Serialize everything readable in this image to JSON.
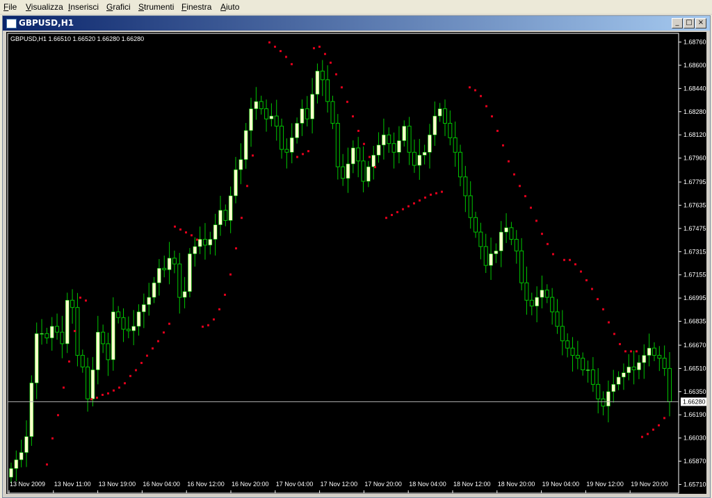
{
  "menu": [
    {
      "label": "File",
      "u": "F",
      "rest": "ile"
    },
    {
      "label": "Visualizza",
      "u": "V",
      "rest": "isualizza"
    },
    {
      "label": "Inserisci",
      "u": "I",
      "rest": "nserisci"
    },
    {
      "label": "Grafici",
      "u": "G",
      "rest": "rafici"
    },
    {
      "label": "Strumenti",
      "u": "S",
      "rest": "trumenti"
    },
    {
      "label": "Finestra",
      "u": "F",
      "rest": "inestra"
    },
    {
      "label": "Aiuto",
      "u": "A",
      "rest": "iuto"
    }
  ],
  "window": {
    "title": "GBPUSD,H1",
    "minimize_glyph": "_",
    "restore_glyph": "□",
    "close_glyph": "×"
  },
  "chart_header": "GBPUSD,H1  1.66510 1.66520 1.66280 1.66280",
  "current_price_label": "1.66280",
  "colors": {
    "background": "#000000",
    "bull_candle": "#ffffcc",
    "wick": "#00c800",
    "psar": "#e0001c",
    "axis_text": "#ffffff",
    "price_line": "#b4b4b4"
  },
  "chart_data": {
    "type": "candlestick",
    "symbol": "GBPUSD",
    "timeframe": "H1",
    "ylim": [
      1.6565,
      1.6882
    ],
    "y_ticks": [
      "1.68760",
      "1.68600",
      "1.68440",
      "1.68280",
      "1.68120",
      "1.67960",
      "1.67795",
      "1.67635",
      "1.67475",
      "1.67315",
      "1.67155",
      "1.66995",
      "1.66835",
      "1.66670",
      "1.66510",
      "1.66350",
      "1.66190",
      "1.66030",
      "1.65870",
      "1.65710"
    ],
    "x_ticks": [
      "13 Nov 2009",
      "13 Nov 11:00",
      "13 Nov 19:00",
      "16 Nov 04:00",
      "16 Nov 12:00",
      "16 Nov 20:00",
      "17 Nov 04:00",
      "17 Nov 12:00",
      "17 Nov 20:00",
      "18 Nov 04:00",
      "18 Nov 12:00",
      "18 Nov 20:00",
      "19 Nov 04:00",
      "19 Nov 12:00",
      "19 Nov 20:00"
    ],
    "close_path": [
      1.6582,
      1.6588,
      1.6593,
      1.6604,
      1.6641,
      1.6675,
      1.6675,
      1.6672,
      1.668,
      1.6676,
      1.6668,
      1.6698,
      1.6693,
      1.666,
      1.6652,
      1.663,
      1.665,
      1.6676,
      1.6668,
      1.6657,
      1.669,
      1.6686,
      1.6678,
      1.6677,
      1.668,
      1.669,
      1.6695,
      1.67,
      1.671,
      1.672,
      1.6719,
      1.6727,
      1.6723,
      1.67,
      1.6704,
      1.673,
      1.6735,
      1.674,
      1.6736,
      1.674,
      1.675,
      1.676,
      1.6753,
      1.677,
      1.6788,
      1.6795,
      1.6815,
      1.683,
      1.6835,
      1.683,
      1.6823,
      1.6825,
      1.6818,
      1.6802,
      1.68,
      1.681,
      1.682,
      1.683,
      1.6823,
      1.684,
      1.6856,
      1.685,
      1.6835,
      1.682,
      1.679,
      1.6782,
      1.6792,
      1.6803,
      1.6794,
      1.678,
      1.679,
      1.6798,
      1.6805,
      1.6812,
      1.6806,
      1.68,
      1.6808,
      1.6818,
      1.68,
      1.6791,
      1.6798,
      1.68,
      1.6812,
      1.6825,
      1.683,
      1.682,
      1.681,
      1.68,
      1.6783,
      1.677,
      1.6755,
      1.6745,
      1.6735,
      1.6722,
      1.673,
      1.6732,
      1.6745,
      1.6748,
      1.674,
      1.6732,
      1.671,
      1.6698,
      1.6694,
      1.67,
      1.6705,
      1.67,
      1.669,
      1.668,
      1.667,
      1.6665,
      1.666,
      1.6658,
      1.665,
      1.665,
      1.664,
      1.663,
      1.6625,
      1.6635,
      1.664,
      1.6645,
      1.6648,
      1.6652,
      1.665,
      1.6655,
      1.666,
      1.6665,
      1.666,
      1.6658,
      1.6651,
      1.6628
    ],
    "psar_dots": [
      [
        58,
        1.6585
      ],
      [
        66,
        1.6603
      ],
      [
        74,
        1.6619
      ],
      [
        82,
        1.6638
      ],
      [
        90,
        1.6656
      ],
      [
        98,
        1.6677
      ],
      [
        106,
        1.67
      ],
      [
        114,
        1.6698
      ],
      [
        122,
        1.663
      ],
      [
        130,
        1.6631
      ],
      [
        138,
        1.6633
      ],
      [
        146,
        1.6634
      ],
      [
        154,
        1.6636
      ],
      [
        162,
        1.6638
      ],
      [
        170,
        1.6641
      ],
      [
        178,
        1.6646
      ],
      [
        186,
        1.665
      ],
      [
        194,
        1.6655
      ],
      [
        202,
        1.666
      ],
      [
        210,
        1.6665
      ],
      [
        218,
        1.667
      ],
      [
        226,
        1.6676
      ],
      [
        234,
        1.6682
      ],
      [
        242,
        1.6749
      ],
      [
        250,
        1.6747
      ],
      [
        258,
        1.6745
      ],
      [
        266,
        1.6743
      ],
      [
        274,
        1.674
      ],
      [
        282,
        1.668
      ],
      [
        290,
        1.6681
      ],
      [
        298,
        1.6685
      ],
      [
        306,
        1.6692
      ],
      [
        314,
        1.6702
      ],
      [
        322,
        1.6716
      ],
      [
        330,
        1.6734
      ],
      [
        338,
        1.6755
      ],
      [
        346,
        1.6777
      ],
      [
        354,
        1.6798
      ],
      [
        378,
        1.6876
      ],
      [
        386,
        1.6873
      ],
      [
        394,
        1.687
      ],
      [
        402,
        1.6866
      ],
      [
        410,
        1.6861
      ],
      [
        418,
        1.6797
      ],
      [
        426,
        1.6799
      ],
      [
        434,
        1.6801
      ],
      [
        442,
        1.6872
      ],
      [
        450,
        1.6873
      ],
      [
        458,
        1.6868
      ],
      [
        466,
        1.6862
      ],
      [
        474,
        1.6854
      ],
      [
        482,
        1.6845
      ],
      [
        490,
        1.6835
      ],
      [
        498,
        1.6825
      ],
      [
        506,
        1.6815
      ],
      [
        514,
        1.6806
      ],
      [
        522,
        1.6797
      ],
      [
        530,
        1.679
      ],
      [
        546,
        1.6755
      ],
      [
        554,
        1.6757
      ],
      [
        562,
        1.6759
      ],
      [
        570,
        1.6761
      ],
      [
        578,
        1.6763
      ],
      [
        586,
        1.6765
      ],
      [
        594,
        1.6767
      ],
      [
        602,
        1.6769
      ],
      [
        610,
        1.6771
      ],
      [
        618,
        1.6772
      ],
      [
        626,
        1.6773
      ],
      [
        666,
        1.6845
      ],
      [
        674,
        1.6843
      ],
      [
        682,
        1.6839
      ],
      [
        690,
        1.6832
      ],
      [
        698,
        1.6825
      ],
      [
        706,
        1.6815
      ],
      [
        714,
        1.6805
      ],
      [
        722,
        1.6794
      ],
      [
        730,
        1.6785
      ],
      [
        738,
        1.6777
      ],
      [
        746,
        1.677
      ],
      [
        754,
        1.6762
      ],
      [
        762,
        1.6753
      ],
      [
        770,
        1.6744
      ],
      [
        778,
        1.6737
      ],
      [
        786,
        1.673
      ],
      [
        802,
        1.6726
      ],
      [
        810,
        1.6726
      ],
      [
        818,
        1.6723
      ],
      [
        826,
        1.6718
      ],
      [
        834,
        1.6712
      ],
      [
        842,
        1.6706
      ],
      [
        850,
        1.6699
      ],
      [
        858,
        1.6692
      ],
      [
        866,
        1.6683
      ],
      [
        874,
        1.6675
      ],
      [
        882,
        1.6668
      ],
      [
        890,
        1.6663
      ],
      [
        898,
        1.6663
      ],
      [
        906,
        1.6663
      ],
      [
        914,
        1.6604
      ],
      [
        922,
        1.6606
      ],
      [
        930,
        1.6609
      ],
      [
        938,
        1.6612
      ],
      [
        946,
        1.6617
      ]
    ]
  }
}
